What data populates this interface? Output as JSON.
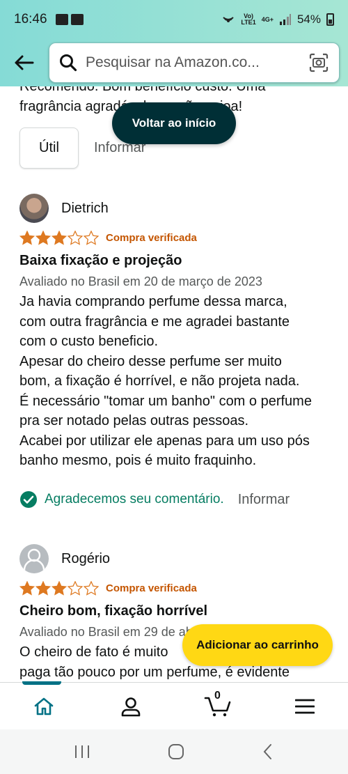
{
  "status": {
    "time": "16:46",
    "battery": "54%",
    "net_top": "Vo)",
    "net_bottom": "LTE1",
    "net_4g": "4G+"
  },
  "header": {
    "search_placeholder": "Pesquisar na Amazon.co..."
  },
  "previous": {
    "text_line1": "Recomendo. Bom benefício custo. Uma",
    "text_line2": "fragrância agradável que não enjoa!",
    "util_label": "Útil",
    "report_label": "Informar"
  },
  "back_to_top": "Voltar ao início",
  "reviews": [
    {
      "author": "Dietrich",
      "rating": 3,
      "verified": "Compra verificada",
      "title": "Baixa fixação e projeção",
      "meta": "Avaliado no Brasil em 20 de março de 2023",
      "body": [
        "Ja havia comprando perfume dessa marca,",
        "com outra fragrância e me agradei bastante",
        "com o custo beneficio.",
        "Apesar do cheiro desse perfume ser muito",
        "bom, a fixação é horrível, e não projeta nada.",
        "É necessário \"tomar um banho\" com o perfume",
        "pra ser notado pelas outras pessoas.",
        "Acabei por utilizar ele apenas para um uso pós",
        "banho mesmo, pois é muito fraquinho."
      ],
      "thanks": "Agradecemos seu comentário.",
      "report_label": "Informar"
    },
    {
      "author": "Rogério",
      "rating": 3,
      "verified": "Compra verificada",
      "title": "Cheiro bom, fixação horrível",
      "meta": "Avaliado no Brasil em 29 de ab",
      "body": [
        "O cheiro de fato é muito",
        "paga tão pouco por um perfume, é evidente"
      ]
    }
  ],
  "add_to_cart": "Adicionar ao carrinho",
  "bottom_nav": {
    "cart_count": "0"
  },
  "colors": {
    "accent": "#007185",
    "header": "#85dbd6",
    "cart_button": "#ffd814",
    "star": "#de7921",
    "verified": "#c45500",
    "thanks": "#067d62"
  }
}
